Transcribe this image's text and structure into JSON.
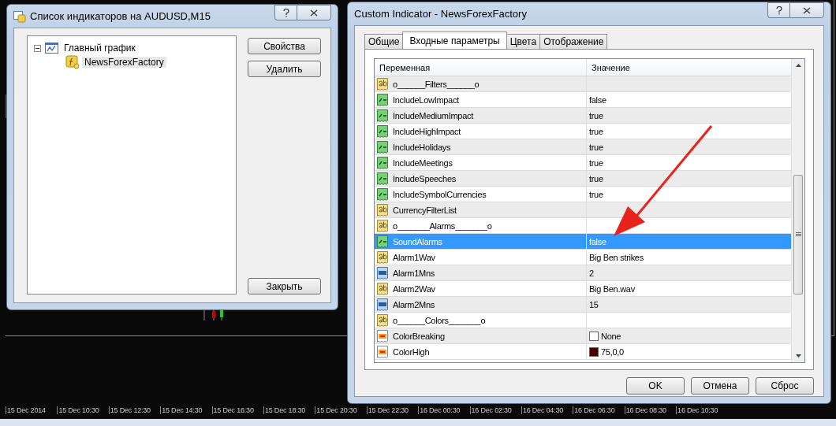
{
  "left_dialog": {
    "title": "Список индикаторов на AUDUSD,M15",
    "tree": [
      {
        "label": "Главный график",
        "expanded": true,
        "children": [
          {
            "label": "NewsForexFactory",
            "selected": true
          }
        ]
      }
    ],
    "buttons": [
      "Свойства",
      "Удалить",
      "Закрыть"
    ]
  },
  "right_dialog": {
    "title": "Custom Indicator - NewsForexFactory",
    "tabs": [
      {
        "label": "Общие",
        "selected": false
      },
      {
        "label": "Входные параметры",
        "selected": true
      },
      {
        "label": "Цвета",
        "selected": false
      },
      {
        "label": "Отображение",
        "selected": false
      }
    ],
    "table": {
      "columns": [
        "Переменная",
        "Значение"
      ],
      "rows": [
        {
          "kind": "string",
          "name": "o______Filters______o",
          "value": "",
          "selected": false
        },
        {
          "kind": "bool",
          "name": "IncludeLowImpact",
          "value": "false",
          "selected": false
        },
        {
          "kind": "bool",
          "name": "IncludeMediumImpact",
          "value": "true",
          "selected": false
        },
        {
          "kind": "bool",
          "name": "IncludeHighImpact",
          "value": "true",
          "selected": false
        },
        {
          "kind": "bool",
          "name": "IncludeHolidays",
          "value": "true",
          "selected": false
        },
        {
          "kind": "bool",
          "name": "IncludeMeetings",
          "value": "true",
          "selected": false
        },
        {
          "kind": "bool",
          "name": "IncludeSpeeches",
          "value": "true",
          "selected": false
        },
        {
          "kind": "bool",
          "name": "IncludeSymbolCurrencies",
          "value": "true",
          "selected": false
        },
        {
          "kind": "string",
          "name": "CurrencyFilterList",
          "value": "",
          "selected": false
        },
        {
          "kind": "string",
          "name": "o_______Alarms_______o",
          "value": "",
          "selected": false
        },
        {
          "kind": "bool",
          "name": "SoundAlarms",
          "value": "false",
          "selected": true
        },
        {
          "kind": "string",
          "name": "Alarm1Wav",
          "value": "Big Ben strikes",
          "selected": false
        },
        {
          "kind": "int",
          "name": "Alarm1Mns",
          "value": "2",
          "selected": false
        },
        {
          "kind": "string",
          "name": "Alarm2Wav",
          "value": "Big Ben.wav",
          "selected": false
        },
        {
          "kind": "int",
          "name": "Alarm2Mns",
          "value": "15",
          "selected": false
        },
        {
          "kind": "string",
          "name": "o______Colors_______o",
          "value": "",
          "selected": false
        },
        {
          "kind": "color",
          "name": "ColorBreaking",
          "value": "None",
          "color": "#ffffff",
          "selected": false
        },
        {
          "kind": "color",
          "name": "ColorHigh",
          "value": "75,0,0",
          "color": "#4b0000",
          "selected": false
        }
      ]
    },
    "buttons": [
      "OK",
      "Отмена",
      "Сброс"
    ]
  },
  "time_axis": [
    "15 Dec 2014",
    "15 Dec 10:30",
    "15 Dec 12:30",
    "15 Dec 14:30",
    "15 Dec 16:30",
    "15 Dec 18:30",
    "15 Dec 20:30",
    "15 Dec 22:30",
    "16 Dec 00:30",
    "16 Dec 02:30",
    "16 Dec 04:30",
    "16 Dec 06:30",
    "16 Dec 08:30",
    "16 Dec 10:30"
  ]
}
